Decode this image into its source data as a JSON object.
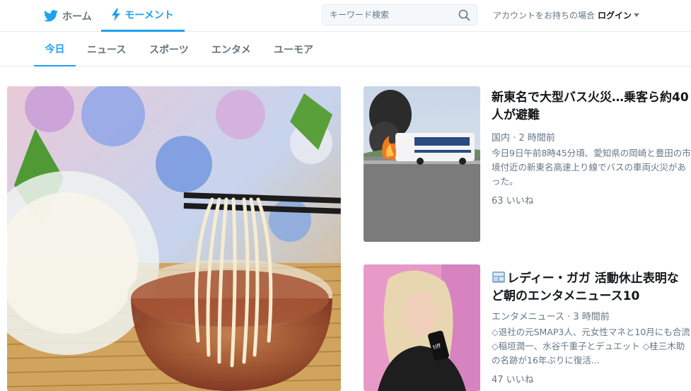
{
  "nav": {
    "home_label": "ホーム",
    "moments_label": "モーメント",
    "search_placeholder": "キーワード検索",
    "account_prompt": "アカウントをお持ちの場合",
    "login_label": "ログイン"
  },
  "tabs": [
    {
      "label": "今日",
      "active": true
    },
    {
      "label": "ニュース",
      "active": false
    },
    {
      "label": "スポーツ",
      "active": false
    },
    {
      "label": "エンタメ",
      "active": false
    },
    {
      "label": "ユーモア",
      "active": false
    }
  ],
  "cards": [
    {
      "title": "新東名で大型バス火災…乗客ら約40人が避難",
      "category": "国内",
      "time": "2 時間前",
      "description": "今日9日午前8時45分頃、愛知県の岡崎と豊田の市境付近の新東名高速上り線でバスの車両火災があった。",
      "likes": "63 いいね"
    },
    {
      "title": "レディー・ガガ 活動休止表明など朝のエンタメニュース10",
      "category": "エンタメニュース",
      "time": "3 時間前",
      "description": "◇退社の元SMAP3人、元女性マネと10月にも合流 ◇稲垣潤一、水谷千重子とデュエット ◇桂三木助の名跡が16年ぶりに復活...",
      "likes": "47 いいね"
    }
  ],
  "colors": {
    "accent": "#1da1f2",
    "muted": "#657786",
    "text": "#14171a",
    "border": "#e6ecf0"
  }
}
